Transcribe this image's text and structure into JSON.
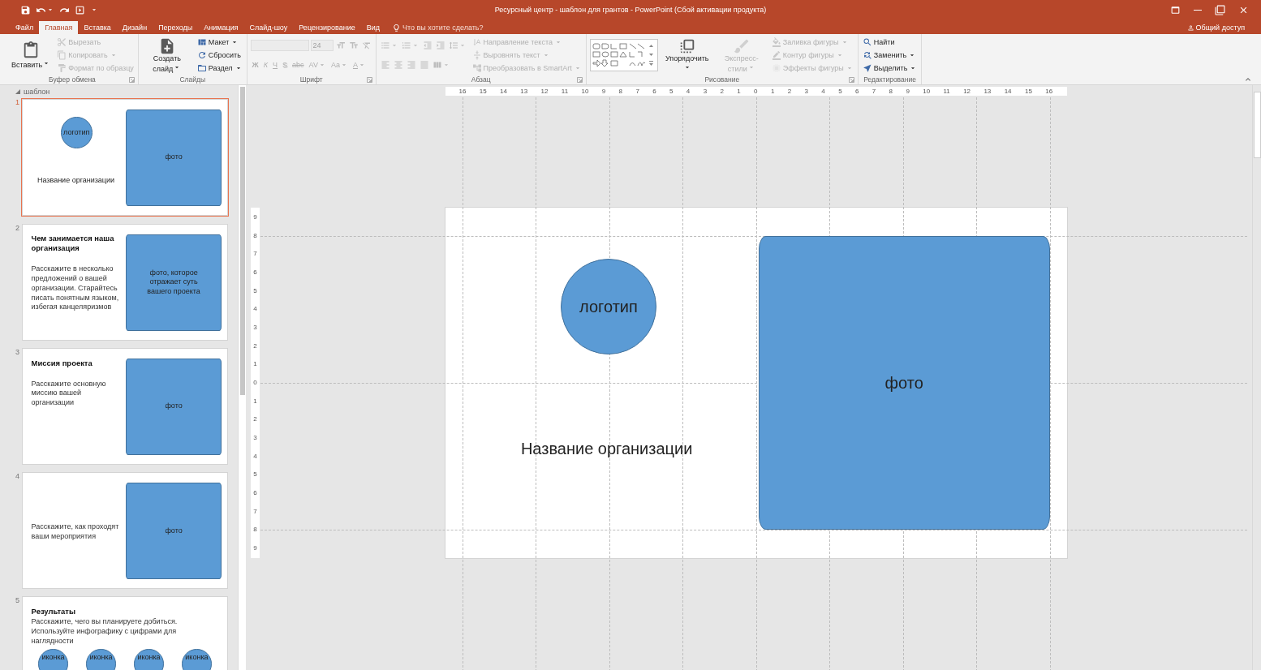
{
  "window": {
    "title": "Ресурсный центр - шаблон для грантов - PowerPoint (Сбой активации продукта)",
    "share": "Общий доступ"
  },
  "tabs": [
    {
      "label": "Файл",
      "selected": false
    },
    {
      "label": "Главная",
      "selected": true
    },
    {
      "label": "Вставка",
      "selected": false
    },
    {
      "label": "Дизайн",
      "selected": false
    },
    {
      "label": "Переходы",
      "selected": false
    },
    {
      "label": "Анимация",
      "selected": false
    },
    {
      "label": "Слайд-шоу",
      "selected": false
    },
    {
      "label": "Рецензирование",
      "selected": false
    },
    {
      "label": "Вид",
      "selected": false
    }
  ],
  "tell_me": {
    "placeholder": "Что вы хотите сделать?"
  },
  "ribbon": {
    "groups": [
      {
        "label": "Буфер обмена",
        "launcher": true,
        "columns": [
          [
            [
              {
                "kind": "large",
                "label": "Вставить",
                "menu": true,
                "disabled": false
              }
            ]
          ],
          [
            [
              {
                "kind": "small",
                "label": "Вырезать",
                "menu": false,
                "disabled": true
              }
            ],
            [
              {
                "kind": "small",
                "label": "Копировать",
                "menu": true,
                "disabled": true
              }
            ],
            [
              {
                "kind": "small",
                "label": "Формат по образцу",
                "menu": false,
                "disabled": true
              }
            ]
          ]
        ]
      },
      {
        "label": "Слайды",
        "launcher": false,
        "columns": [
          [
            [
              {
                "kind": "large",
                "label": "Создать слайд",
                "menu": true,
                "disabled": false
              }
            ]
          ],
          [
            [
              {
                "kind": "small",
                "label": "Макет",
                "menu": true,
                "disabled": false
              }
            ],
            [
              {
                "kind": "small",
                "label": "Сбросить",
                "menu": false,
                "disabled": false
              }
            ],
            [
              {
                "kind": "small",
                "label": "Раздел",
                "menu": true,
                "disabled": false
              }
            ]
          ]
        ]
      },
      {
        "label": "Шрифт",
        "launcher": true,
        "columns": [
          [
            [
              {
                "kind": "font-field",
                "disabled": true
              },
              {
                "kind": "size-field",
                "value": "24",
                "disabled": true
              },
              {
                "kind": "icon",
                "menu": false,
                "disabled": true
              },
              {
                "kind": "icon",
                "menu": false,
                "disabled": true
              },
              {
                "kind": "icon",
                "menu": false,
                "disabled": true
              }
            ],
            [
              {
                "kind": "glyph",
                "label": "Ж",
                "menu": false,
                "disabled": true
              },
              {
                "kind": "glyph",
                "label": "К",
                "menu": false,
                "disabled": true
              },
              {
                "kind": "glyph",
                "label": "Ч",
                "menu": false,
                "disabled": true
              },
              {
                "kind": "glyph",
                "label": "S",
                "menu": false,
                "disabled": true
              },
              {
                "kind": "glyph",
                "label": "abc",
                "menu": false,
                "disabled": true
              },
              {
                "kind": "glyph",
                "label": "AV",
                "menu": true,
                "disabled": true
              },
              {
                "kind": "glyph",
                "label": "Aa",
                "menu": true,
                "disabled": true
              },
              {
                "kind": "glyph",
                "label": "A",
                "menu": true,
                "disabled": true
              }
            ]
          ]
        ]
      },
      {
        "label": "Абзац",
        "launcher": true,
        "columns": [
          [
            [
              {
                "kind": "icon",
                "menu": true,
                "disabled": true
              },
              {
                "kind": "icon",
                "menu": true,
                "disabled": true
              },
              {
                "kind": "icon",
                "menu": false,
                "disabled": true
              },
              {
                "kind": "icon",
                "menu": false,
                "disabled": true
              },
              {
                "kind": "icon",
                "menu": true,
                "disabled": true
              }
            ],
            [
              {
                "kind": "icon",
                "menu": false,
                "disabled": true
              },
              {
                "kind": "icon",
                "menu": false,
                "disabled": true
              },
              {
                "kind": "icon",
                "menu": false,
                "disabled": true
              },
              {
                "kind": "icon",
                "menu": false,
                "disabled": true
              },
              {
                "kind": "icon",
                "menu": true,
                "disabled": true
              }
            ]
          ],
          [
            [
              {
                "kind": "small",
                "label": "Направление текста",
                "menu": true,
                "disabled": true
              }
            ],
            [
              {
                "kind": "small",
                "label": "Выровнять текст",
                "menu": true,
                "disabled": true
              }
            ],
            [
              {
                "kind": "small",
                "label": "Преобразовать в SmartArt",
                "menu": true,
                "disabled": true
              }
            ]
          ]
        ]
      },
      {
        "label": "Рисование",
        "launcher": true,
        "columns": [
          [
            [
              {
                "kind": "gallery",
                "disabled": false
              }
            ]
          ],
          [
            [
              {
                "kind": "large",
                "label": "Упорядочить",
                "menu": true,
                "disabled": false
              }
            ]
          ],
          [
            [
              {
                "kind": "large",
                "label": "Экспресс-стили",
                "menu": true,
                "disabled": true
              }
            ]
          ],
          [
            [
              {
                "kind": "small",
                "label": "Заливка фигуры",
                "menu": true,
                "disabled": true
              }
            ],
            [
              {
                "kind": "small",
                "label": "Контур фигуры",
                "menu": true,
                "disabled": true
              }
            ],
            [
              {
                "kind": "small",
                "label": "Эффекты фигуры",
                "menu": true,
                "disabled": true
              }
            ]
          ]
        ]
      },
      {
        "label": "Редактирование",
        "launcher": false,
        "columns": [
          [
            [
              {
                "kind": "small",
                "label": "Найти",
                "menu": false,
                "disabled": false
              }
            ],
            [
              {
                "kind": "small",
                "label": "Заменить",
                "menu": true,
                "disabled": false
              }
            ],
            [
              {
                "kind": "small",
                "label": "Выделить",
                "menu": true,
                "disabled": false
              }
            ]
          ]
        ]
      }
    ]
  },
  "slides_panel": {
    "section": {
      "label": "шаблон",
      "expanded": true
    },
    "slides": [
      {
        "number": "1",
        "selected": true,
        "elements": [
          {
            "kind": "logo",
            "text": "логотип"
          },
          {
            "kind": "org-name",
            "text": "Название организации"
          },
          {
            "kind": "photo",
            "text": "фото"
          }
        ]
      },
      {
        "number": "2",
        "selected": false,
        "elements": [
          {
            "kind": "title",
            "text": "Чем занимается наша организация"
          },
          {
            "kind": "body",
            "text": "Расскажите в несколько предложений о вашей организации. Старайтесь писать понятным языком, избегая канцеляризмов"
          },
          {
            "kind": "photo",
            "text": "фото, которое отражает суть вашего проекта"
          }
        ]
      },
      {
        "number": "3",
        "selected": false,
        "elements": [
          {
            "kind": "title",
            "text": "Миссия проекта"
          },
          {
            "kind": "body",
            "text": "Расскажите основную миссию вашей организации"
          },
          {
            "kind": "photo",
            "text": "фото"
          }
        ]
      },
      {
        "number": "4",
        "selected": false,
        "elements": [
          {
            "kind": "body",
            "text": "Расскажите, как проходят ваши мероприятия"
          },
          {
            "kind": "photo",
            "text": "фото"
          }
        ]
      },
      {
        "number": "5",
        "selected": false,
        "elements": [
          {
            "kind": "title",
            "text": "Результаты"
          },
          {
            "kind": "lead",
            "text": "Расскажите, чего вы планируете добиться. Используйте инфографику с цифрами для наглядности"
          },
          {
            "kind": "icon",
            "text": "иконка"
          },
          {
            "kind": "icon",
            "text": "иконка"
          },
          {
            "kind": "icon",
            "text": "иконка"
          },
          {
            "kind": "icon",
            "text": "иконка"
          }
        ]
      }
    ]
  },
  "editor": {
    "horizontal_ruler": [
      "16",
      "15",
      "14",
      "13",
      "12",
      "11",
      "10",
      "9",
      "8",
      "7",
      "6",
      "5",
      "4",
      "3",
      "2",
      "1",
      "0",
      "1",
      "2",
      "3",
      "4",
      "5",
      "6",
      "7",
      "8",
      "9",
      "10",
      "11",
      "12",
      "13",
      "14",
      "15",
      "16"
    ],
    "vertical_ruler": [
      "9",
      "8",
      "7",
      "6",
      "5",
      "4",
      "3",
      "2",
      "1",
      "0",
      "1",
      "2",
      "3",
      "4",
      "5",
      "6",
      "7",
      "8",
      "9"
    ],
    "elements": [
      {
        "kind": "logo",
        "text": "логотип"
      },
      {
        "kind": "org-name",
        "text": "Название организации"
      },
      {
        "kind": "photo",
        "text": "фото"
      }
    ]
  }
}
